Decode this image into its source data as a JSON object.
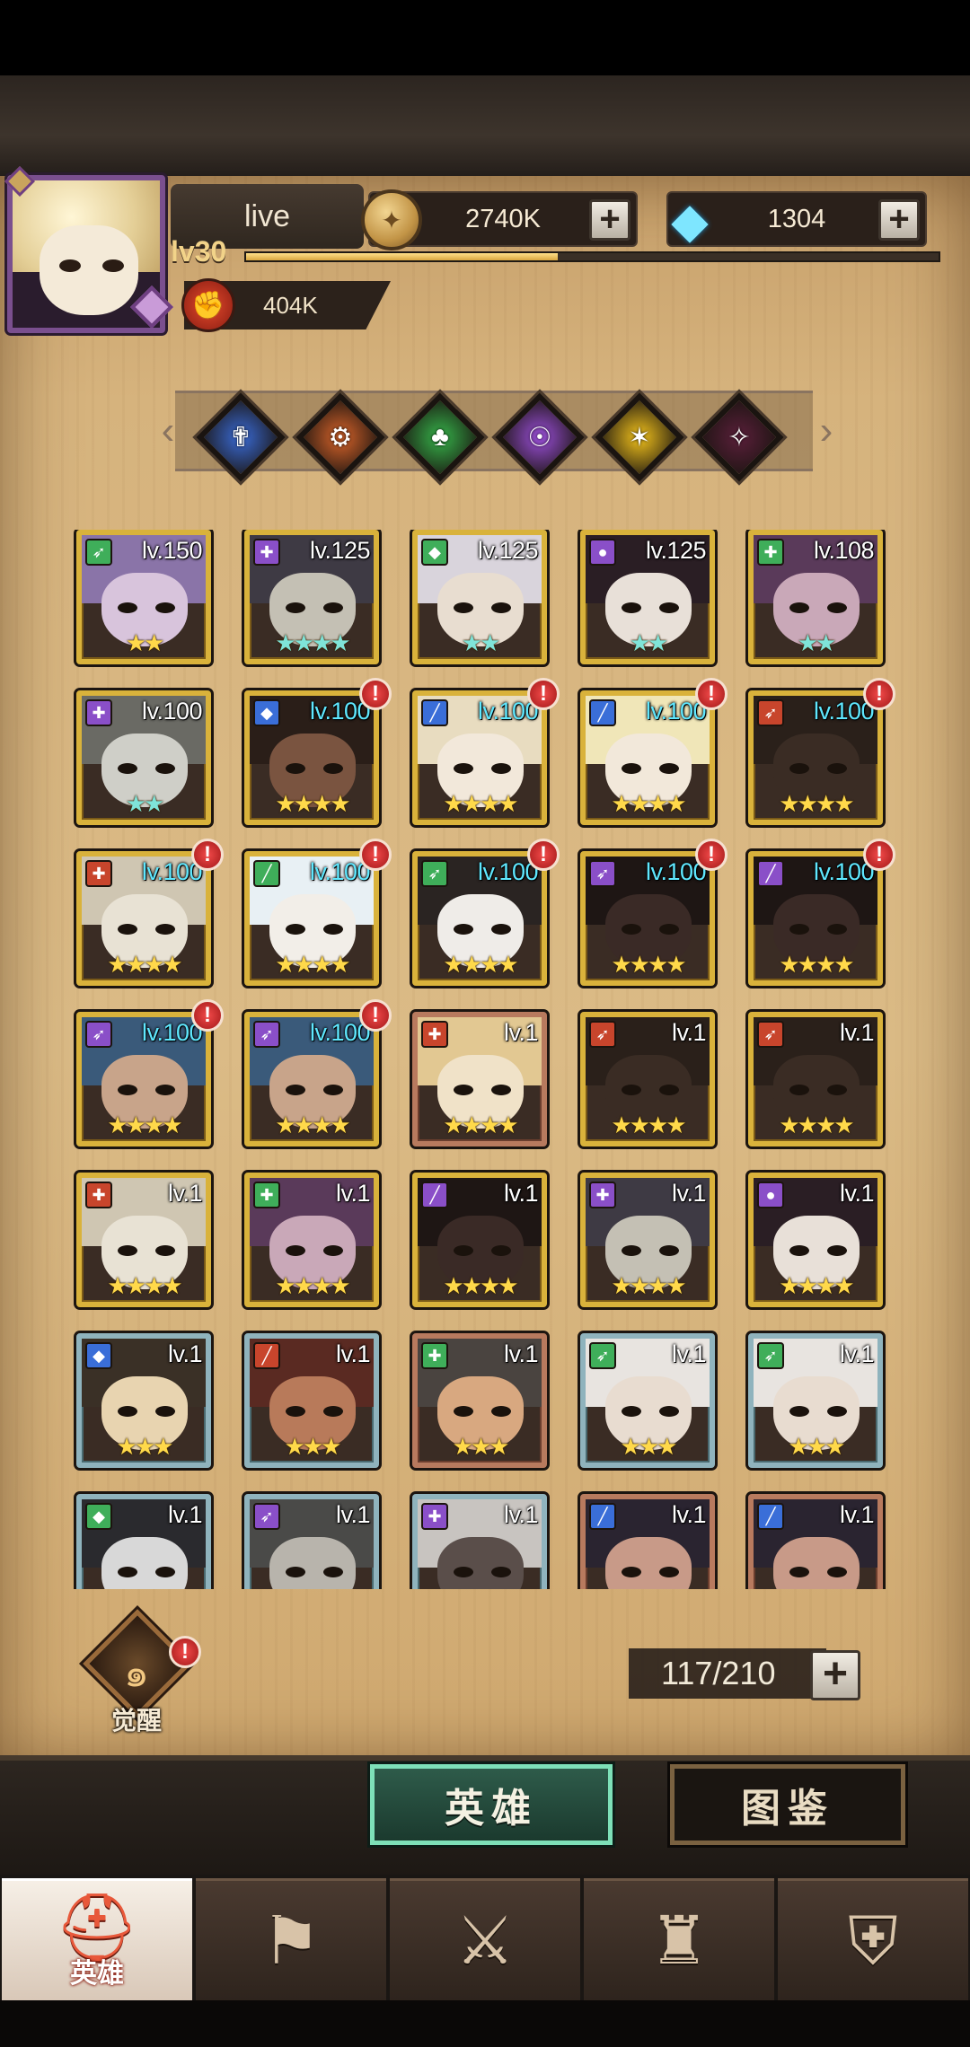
{
  "player": {
    "name": "live",
    "level": "lv30",
    "power": "404K",
    "xp_fraction": 0.45
  },
  "currency": {
    "gold": "2740K",
    "diamonds": "1304"
  },
  "filters": [
    {
      "name": "faction-light",
      "color": "#3a6bd6",
      "glyph": "✟"
    },
    {
      "name": "faction-fire",
      "color": "#d9642a",
      "glyph": "⚙"
    },
    {
      "name": "faction-nature",
      "color": "#36b34a",
      "glyph": "♣"
    },
    {
      "name": "faction-mystic",
      "color": "#9b4fd9",
      "glyph": "☉"
    },
    {
      "name": "faction-sun",
      "color": "#f2c21c",
      "glyph": "✶"
    },
    {
      "name": "faction-shadow",
      "color": "#5a1f3a",
      "glyph": "✧"
    }
  ],
  "class_colors": {
    "g": "#3fae5a",
    "p": "#8a4fc8",
    "b": "#3a6ed8",
    "r": "#c8452c"
  },
  "class_glyphs": {
    "bow": "➶",
    "heal": "✚",
    "shield": "◆",
    "orb": "●",
    "sword": "╱",
    "staff": "⚕"
  },
  "heroes": [
    {
      "level": "lv.150",
      "stars": "★★",
      "rarity": "gold",
      "cls": "g",
      "glyph": "bow",
      "skin": "#d8c4dc",
      "hair": "#8a74a8"
    },
    {
      "level": "lv.125",
      "stars": "★★★★",
      "rarity": "gold",
      "cls": "p",
      "glyph": "heal",
      "skin": "#c4c0b4",
      "hair": "#3e3a44",
      "teal": true
    },
    {
      "level": "lv.125",
      "stars": "★★",
      "rarity": "gold",
      "cls": "g",
      "glyph": "shield",
      "skin": "#e8ddd0",
      "hair": "#d9d4dc",
      "teal": true
    },
    {
      "level": "lv.125",
      "stars": "★★",
      "rarity": "gold",
      "cls": "p",
      "glyph": "orb",
      "skin": "#e8e0d8",
      "hair": "#2a1e24",
      "teal": true
    },
    {
      "level": "lv.108",
      "stars": "★★",
      "rarity": "gold",
      "cls": "g",
      "glyph": "heal",
      "skin": "#c9a8b8",
      "hair": "#5a3a5a",
      "teal": true
    },
    {
      "level": "lv.100",
      "stars": "★★",
      "rarity": "gold",
      "cls": "p",
      "glyph": "heal",
      "skin": "#cfcfc8",
      "hair": "#6a6a64",
      "teal": true
    },
    {
      "level": "lv.100",
      "stars": "★★★★",
      "rarity": "gold",
      "cls": "b",
      "glyph": "shield",
      "skin": "#7a5440",
      "hair": "#2a1e18",
      "cyan": true,
      "alert": true
    },
    {
      "level": "lv.100",
      "stars": "★★★★",
      "rarity": "gold",
      "cls": "b",
      "glyph": "sword",
      "skin": "#f2e8da",
      "hair": "#e8dcc0",
      "cyan": true,
      "alert": true
    },
    {
      "level": "lv.100",
      "stars": "★★★★",
      "rarity": "gold",
      "cls": "b",
      "glyph": "sword",
      "skin": "#f2e8da",
      "hair": "#f0e6b8",
      "cyan": true,
      "alert": true
    },
    {
      "level": "lv.100",
      "stars": "★★★★",
      "rarity": "gold",
      "cls": "r",
      "glyph": "bow",
      "skin": "#3a2c24",
      "hair": "#2a201a",
      "cyan": true,
      "alert": true
    },
    {
      "level": "lv.100",
      "stars": "★★★★",
      "rarity": "gold",
      "cls": "r",
      "glyph": "heal",
      "skin": "#e8e2d4",
      "hair": "#cfc6b2",
      "cyan": true,
      "alert": true
    },
    {
      "level": "lv.100",
      "stars": "★★★★",
      "rarity": "gold",
      "cls": "g",
      "glyph": "sword",
      "skin": "#f2eee8",
      "hair": "#e8f0f4",
      "cyan": true,
      "alert": true
    },
    {
      "level": "lv.100",
      "stars": "★★★★",
      "rarity": "gold",
      "cls": "g",
      "glyph": "bow",
      "skin": "#efece8",
      "hair": "#2a2422",
      "cyan": true,
      "alert": true
    },
    {
      "level": "lv.100",
      "stars": "★★★★",
      "rarity": "gold",
      "cls": "p",
      "glyph": "bow",
      "skin": "#3a2a26",
      "hair": "#1e1614",
      "cyan": true,
      "alert": true
    },
    {
      "level": "lv.100",
      "stars": "★★★★",
      "rarity": "gold",
      "cls": "p",
      "glyph": "sword",
      "skin": "#3a2a26",
      "hair": "#1e1614",
      "cyan": true,
      "alert": true
    },
    {
      "level": "lv.100",
      "stars": "★★★★",
      "rarity": "gold",
      "cls": "p",
      "glyph": "bow",
      "skin": "#c8a48a",
      "hair": "#3a5a7a",
      "cyan": true,
      "alert": true
    },
    {
      "level": "lv.100",
      "stars": "★★★★",
      "rarity": "gold",
      "cls": "p",
      "glyph": "bow",
      "skin": "#c8a48a",
      "hair": "#3a5a7a",
      "cyan": true,
      "alert": true
    },
    {
      "level": "lv.1",
      "stars": "★★★★",
      "rarity": "bronze",
      "cls": "r",
      "glyph": "heal",
      "skin": "#f0e2c8",
      "hair": "#e2c892"
    },
    {
      "level": "lv.1",
      "stars": "★★★★",
      "rarity": "gold",
      "cls": "r",
      "glyph": "bow",
      "skin": "#3a2c24",
      "hair": "#2a201a"
    },
    {
      "level": "lv.1",
      "stars": "★★★★",
      "rarity": "gold",
      "cls": "r",
      "glyph": "bow",
      "skin": "#3a2c24",
      "hair": "#2a201a"
    },
    {
      "level": "lv.1",
      "stars": "★★★★",
      "rarity": "gold",
      "cls": "r",
      "glyph": "heal",
      "skin": "#e8e2d4",
      "hair": "#cfc6b2"
    },
    {
      "level": "lv.1",
      "stars": "★★★★",
      "rarity": "gold",
      "cls": "g",
      "glyph": "heal",
      "skin": "#c9a8b8",
      "hair": "#5a3a5a"
    },
    {
      "level": "lv.1",
      "stars": "★★★★",
      "rarity": "gold",
      "cls": "p",
      "glyph": "sword",
      "skin": "#3a2a26",
      "hair": "#1e1614"
    },
    {
      "level": "lv.1",
      "stars": "★★★★",
      "rarity": "gold",
      "cls": "p",
      "glyph": "heal",
      "skin": "#c4c0b4",
      "hair": "#3e3a44"
    },
    {
      "level": "lv.1",
      "stars": "★★★★",
      "rarity": "gold",
      "cls": "p",
      "glyph": "orb",
      "skin": "#e8e0d8",
      "hair": "#2a1e24"
    },
    {
      "level": "lv.1",
      "stars": "★★★",
      "rarity": "silver",
      "cls": "b",
      "glyph": "shield",
      "skin": "#e8d4b0",
      "hair": "#3a3026"
    },
    {
      "level": "lv.1",
      "stars": "★★★",
      "rarity": "silver",
      "cls": "r",
      "glyph": "sword",
      "skin": "#b87a5a",
      "hair": "#5a2a22"
    },
    {
      "level": "lv.1",
      "stars": "★★★",
      "rarity": "bronze",
      "cls": "g",
      "glyph": "heal",
      "skin": "#d8a880",
      "hair": "#4a4440"
    },
    {
      "level": "lv.1",
      "stars": "★★★",
      "rarity": "silver",
      "cls": "g",
      "glyph": "bow",
      "skin": "#e8dcd0",
      "hair": "#e8e4e0"
    },
    {
      "level": "lv.1",
      "stars": "★★★",
      "rarity": "silver",
      "cls": "g",
      "glyph": "bow",
      "skin": "#e8dcd0",
      "hair": "#e8e4e0"
    },
    {
      "level": "lv.1",
      "stars": "★★★",
      "rarity": "silver",
      "cls": "g",
      "glyph": "shield",
      "skin": "#d8d8d8",
      "hair": "#2a2a2e"
    },
    {
      "level": "lv.1",
      "stars": "★★★",
      "rarity": "silver",
      "cls": "p",
      "glyph": "bow",
      "skin": "#b8b4ac",
      "hair": "#4a4a48"
    },
    {
      "level": "lv.1",
      "stars": "★★★",
      "rarity": "silver",
      "cls": "p",
      "glyph": "heal",
      "skin": "#5a4e4a",
      "hair": "#c8c4c0"
    },
    {
      "level": "lv.1",
      "stars": "★★★",
      "rarity": "bronze",
      "cls": "b",
      "glyph": "sword",
      "skin": "#c89a88",
      "hair": "#2a2430"
    },
    {
      "level": "lv.1",
      "stars": "★★★",
      "rarity": "bronze",
      "cls": "b",
      "glyph": "sword",
      "skin": "#c89a88",
      "hair": "#2a2430"
    }
  ],
  "awaken": {
    "label": "觉醒"
  },
  "capacity": "117/210",
  "view_tabs": {
    "heroes": "英雄",
    "codex": "图鉴"
  },
  "nav": [
    {
      "name": "nav-heroes",
      "icon": "⛑",
      "label": "英雄",
      "active": true
    },
    {
      "name": "nav-adventure",
      "icon": "⚑",
      "label": ""
    },
    {
      "name": "nav-battle",
      "icon": "⚔",
      "label": ""
    },
    {
      "name": "nav-castle",
      "icon": "♜",
      "label": ""
    },
    {
      "name": "nav-guild",
      "icon": "⛨",
      "label": ""
    }
  ]
}
